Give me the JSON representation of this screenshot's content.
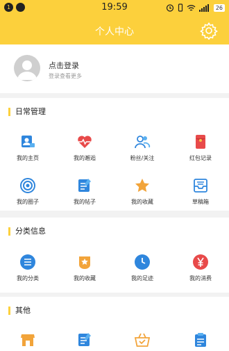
{
  "status_bar": {
    "notif1": "1",
    "time": "19:59",
    "battery": "26"
  },
  "header": {
    "title": "个人中心"
  },
  "profile": {
    "login": "点击登录",
    "subtitle": "登录查看更多"
  },
  "sections": {
    "daily": {
      "title": "日常管理",
      "items": [
        "我的主页",
        "我的邂逅",
        "粉丝/关注",
        "红包记录",
        "我的圈子",
        "我的帖子",
        "我的收藏",
        "草稿箱"
      ]
    },
    "category": {
      "title": "分类信息",
      "items": [
        "我的分类",
        "我的收藏",
        "我的足迹",
        "我的消费"
      ]
    },
    "other": {
      "title": "其他"
    }
  },
  "colors": {
    "accent": "#fcd03c",
    "blue": "#2f86dd",
    "red": "#e84a4a",
    "orange": "#f2a43a"
  }
}
